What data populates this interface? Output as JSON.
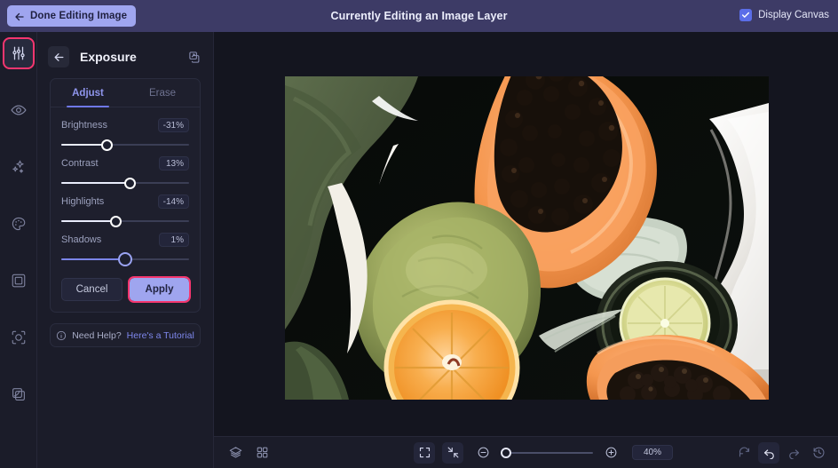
{
  "topbar": {
    "done_label": "Done Editing Image",
    "back_icon": "arrow-left-icon",
    "title": "Currently Editing an Image Layer",
    "display_canvas_label": "Display Canvas",
    "display_canvas_checked": true,
    "bg_color": "#3d3b66",
    "button_color": "#9fa5ef"
  },
  "rail": {
    "items": [
      {
        "name": "adjustments-icon",
        "label": "Adjust",
        "selected": true
      },
      {
        "name": "eye-icon",
        "label": "Effects",
        "selected": false
      },
      {
        "name": "sparkles-icon",
        "label": "Magic",
        "selected": false
      },
      {
        "name": "palette-icon",
        "label": "Color",
        "selected": false
      },
      {
        "name": "frame-icon",
        "label": "Frame",
        "selected": false
      },
      {
        "name": "blur-icon",
        "label": "Blur",
        "selected": false
      },
      {
        "name": "layers-copy-icon",
        "label": "Duplicate",
        "selected": false
      }
    ],
    "selected_outline_color": "#f5366f"
  },
  "panel": {
    "back_icon": "arrow-left-icon",
    "title": "Exposure",
    "copy_icon": "duplicate-icon",
    "tabs": [
      {
        "label": "Adjust",
        "active": true
      },
      {
        "label": "Erase",
        "active": false
      }
    ],
    "sliders": [
      {
        "label": "Brightness",
        "value": "-31%",
        "pct": 36,
        "active": false
      },
      {
        "label": "Contrast",
        "value": "13%",
        "pct": 54,
        "active": false
      },
      {
        "label": "Highlights",
        "value": "-14%",
        "pct": 43,
        "active": false
      },
      {
        "label": "Shadows",
        "value": "1%",
        "pct": 50,
        "active": true
      }
    ],
    "cancel_label": "Cancel",
    "apply_label": "Apply",
    "apply_outline_color": "#f5366f",
    "help": {
      "icon": "info-icon",
      "prompt": "Need Help?",
      "link": "Here's a Tutorial"
    }
  },
  "bottombar": {
    "left_tools": [
      {
        "name": "layers-icon",
        "boxed": false
      },
      {
        "name": "grid-icon",
        "boxed": false
      }
    ],
    "center_tools": [
      {
        "name": "fit-screen-icon",
        "boxed": true
      },
      {
        "name": "shrink-icon",
        "boxed": true
      }
    ],
    "zoom_out_icon": "minus-circle-icon",
    "zoom_in_icon": "plus-circle-icon",
    "zoom_value": "40%",
    "zoom_pct": 0,
    "right_tools": [
      {
        "name": "reset-icon",
        "boxed": false
      },
      {
        "name": "undo-icon",
        "boxed": true
      },
      {
        "name": "redo-icon",
        "boxed": false
      },
      {
        "name": "history-icon",
        "boxed": false
      }
    ]
  },
  "canvas": {
    "name": "image-canvas",
    "description": "Stylized painted still-life photograph of sliced fruit: halved papaya with black seeds, a green melon, a lemon slice in a dark bowl, an orange slice, and a second papaya half on a dark background with a white cloth."
  }
}
